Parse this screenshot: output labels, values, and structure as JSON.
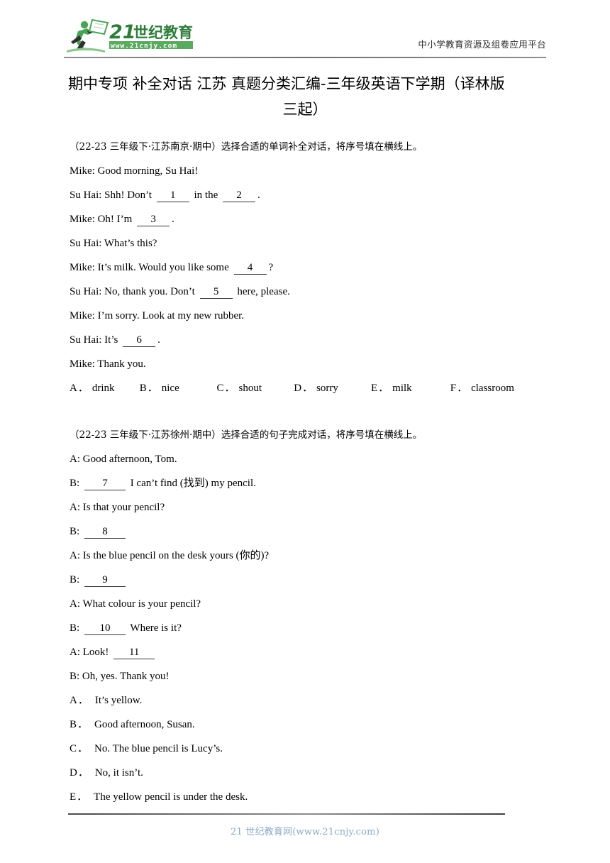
{
  "header": {
    "logo_alt": "21世纪教育",
    "logo_brand": "21世纪教育",
    "logo_url": "www.21cnjy.com",
    "tagline": "中小学教育资源及组卷应用平台"
  },
  "title": {
    "line1": "期中专项 补全对话 江苏 真题分类汇编-三年级英语下学期（译林版",
    "line2": "三起）"
  },
  "sections": [
    {
      "prompt": "（22-23 三年级下·江苏南京·期中）选择合适的单词补全对话，将序号填在横线上。",
      "dialogue": [
        {
          "pre": "Mike: Good morning, Su Hai!",
          "blanks": []
        },
        {
          "pre": "Su Hai: Shh! Don’t",
          "blank1": "1",
          "mid": "in the",
          "blank2": "2",
          "post": "."
        },
        {
          "pre": "Mike: Oh! I’m",
          "blank1": "3",
          "post": "."
        },
        {
          "pre": "Su Hai: What’s this?",
          "blanks": []
        },
        {
          "pre": "Mike: It’s milk. Would you like some",
          "blank1": "4",
          "post": "?"
        },
        {
          "pre": "Su Hai: No, thank you. Don’t",
          "blank1": "5",
          "post": "here, please."
        },
        {
          "pre": "Mike: I’m sorry. Look at my new rubber.",
          "blanks": []
        },
        {
          "pre": "Su Hai: It’s",
          "blank1": "6",
          "post": "."
        },
        {
          "pre": "Mike: Thank you.",
          "blanks": []
        }
      ],
      "options_inline": [
        {
          "key": "A．",
          "value": "drink"
        },
        {
          "key": "B．",
          "value": "nice"
        },
        {
          "key": "C．",
          "value": "shout"
        },
        {
          "key": "D．",
          "value": "sorry"
        },
        {
          "key": "E．",
          "value": "milk"
        },
        {
          "key": "F．",
          "value": "classroom"
        }
      ]
    },
    {
      "prompt": "（22-23 三年级下·江苏徐州·期中）选择合适的句子完成对话，将序号填在横线上。",
      "dialogue": [
        {
          "pre": "A: Good afternoon, Tom.",
          "blanks": []
        },
        {
          "pre": "B:",
          "blank1": "7",
          "post": "I can’t find (找到) my pencil."
        },
        {
          "pre": "A: Is that your pencil?",
          "blanks": []
        },
        {
          "pre": "B:",
          "blank1": "8",
          "post": ""
        },
        {
          "pre": "A: Is the blue pencil on the desk yours (你的)?",
          "blanks": []
        },
        {
          "pre": "B:",
          "blank1": "9",
          "post": ""
        },
        {
          "pre": "A: What colour is your pencil?",
          "blanks": []
        },
        {
          "pre": "B:",
          "blank1": "10",
          "post": "Where is it?"
        },
        {
          "pre": "A: Look!",
          "blank1": "11",
          "post": ""
        },
        {
          "pre": "B: Oh, yes. Thank you!",
          "blanks": []
        }
      ],
      "options_list": [
        {
          "key": "A．",
          "value": "It’s yellow."
        },
        {
          "key": "B．",
          "value": "Good afternoon, Susan."
        },
        {
          "key": "C．",
          "value": "No. The blue pencil is Lucy’s."
        },
        {
          "key": "D．",
          "value": "No, it isn’t."
        },
        {
          "key": "E．",
          "value": "The yellow pencil is under the desk."
        }
      ]
    }
  ],
  "footer": {
    "text": "21 世纪教育网(www.21cnjy.com)"
  },
  "colors": {
    "logo_green": "#3f9a4e",
    "logo_dark_green": "#2e7d3a",
    "footer_blue": "#8aa8c4",
    "rule_gray": "#6f6f6f"
  }
}
